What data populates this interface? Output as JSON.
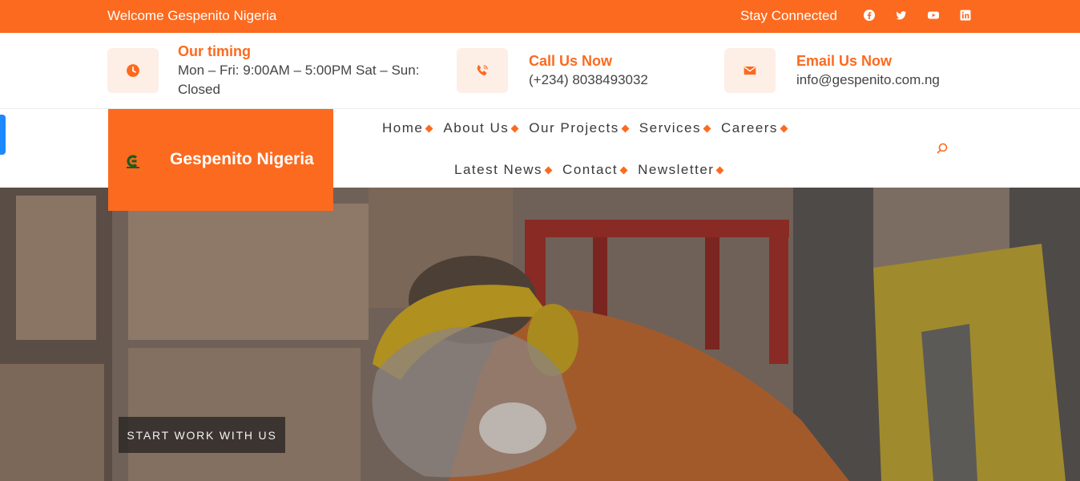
{
  "topbar": {
    "welcome": "Welcome Gespenito Nigeria",
    "stay_connected": "Stay Connected",
    "social": [
      "facebook-icon",
      "twitter-icon",
      "youtube-icon",
      "linkedin-icon"
    ]
  },
  "contact": {
    "timing_title": "Our timing",
    "timing_text": "Mon – Fri: 9:00AM – 5:00PM Sat – Sun: Closed",
    "call_title": "Call Us Now",
    "call_text": "(+234) 8038493032",
    "email_title": "Email Us Now",
    "email_text": "info@gespenito.com.ng"
  },
  "logo": {
    "name": "Gespenito Nigeria"
  },
  "nav": {
    "row1": [
      "Home",
      "About Us",
      "Our Projects",
      "Services",
      "Careers"
    ],
    "row2": [
      "Latest News",
      "Contact",
      "Newsletter"
    ]
  },
  "hero": {
    "cta": "START WORK WITH US"
  },
  "colors": {
    "accent": "#fc6a1f",
    "tab": "#1e88ff"
  }
}
